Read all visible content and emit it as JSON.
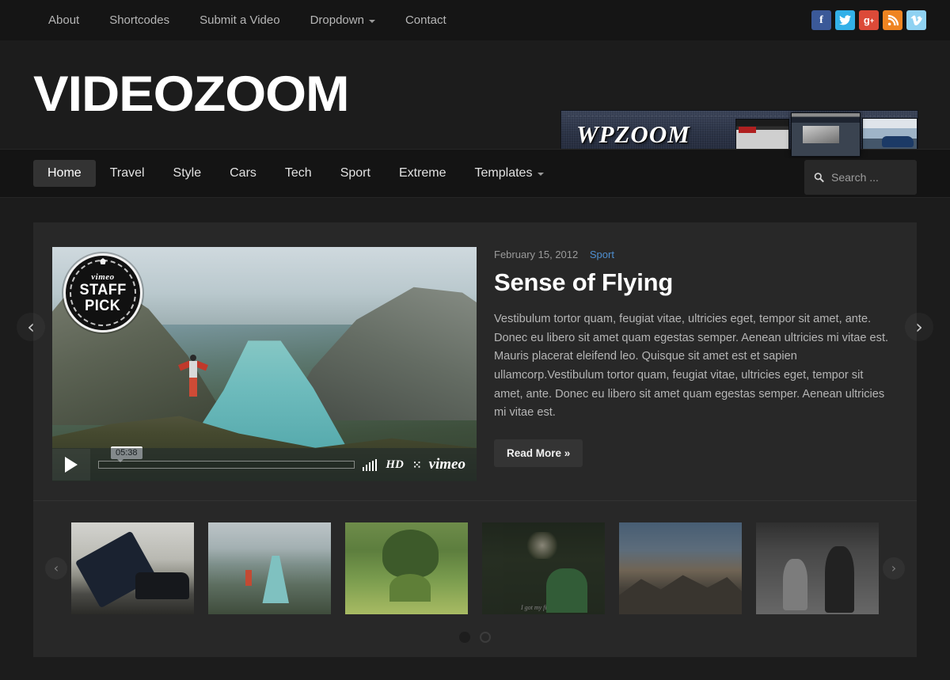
{
  "topbar": {
    "nav": [
      {
        "label": "About",
        "has_caret": false
      },
      {
        "label": "Shortcodes",
        "has_caret": false
      },
      {
        "label": "Submit a Video",
        "has_caret": false
      },
      {
        "label": "Dropdown",
        "has_caret": true
      },
      {
        "label": "Contact",
        "has_caret": false
      }
    ],
    "social": [
      {
        "name": "facebook",
        "glyph": "f",
        "color": "#3b5998"
      },
      {
        "name": "twitter",
        "glyph": "t",
        "color": "#33b0e8"
      },
      {
        "name": "google-plus",
        "glyph": "g+",
        "color": "#dc4a38"
      },
      {
        "name": "rss",
        "glyph": "rss",
        "color": "#ef8421"
      },
      {
        "name": "vimeo",
        "glyph": "v",
        "color": "#8fd2f2"
      }
    ]
  },
  "header": {
    "logo": "VIDEOZOOM",
    "banner": {
      "word": "WPZOOM"
    }
  },
  "mainnav": {
    "items": [
      {
        "label": "Home",
        "active": true,
        "has_caret": false
      },
      {
        "label": "Travel",
        "active": false,
        "has_caret": false
      },
      {
        "label": "Style",
        "active": false,
        "has_caret": false
      },
      {
        "label": "Cars",
        "active": false,
        "has_caret": false
      },
      {
        "label": "Tech",
        "active": false,
        "has_caret": false
      },
      {
        "label": "Sport",
        "active": false,
        "has_caret": false
      },
      {
        "label": "Extreme",
        "active": false,
        "has_caret": false
      },
      {
        "label": "Templates",
        "active": false,
        "has_caret": true
      }
    ],
    "search": {
      "placeholder": "Search ...",
      "value": ""
    }
  },
  "feature": {
    "date": "February 15, 2012",
    "category": "Sport",
    "title": "Sense of Flying",
    "excerpt": "Vestibulum tortor quam, feugiat vitae, ultricies eget, tempor sit amet, ante. Donec eu libero sit amet quam egestas semper. Aenean ultricies mi vitae est. Mauris placerat eleifend leo. Quisque sit amet est et sapien ullamcorp.Vestibulum tortor quam, feugiat vitae, ultricies eget, tempor sit amet, ante. Donec eu libero sit amet quam egestas semper. Aenean ultricies mi vitae est.",
    "read_more": "Read More »",
    "prev_arrow": "‹",
    "next_arrow": "›",
    "player": {
      "badge_brand": "vimeo",
      "badge_line1": "STAFF",
      "badge_line2": "PICK",
      "duration": "05:38",
      "hd_label": "HD",
      "brand": "vimeo"
    }
  },
  "carousel": {
    "prev_arrow": "‹",
    "next_arrow": "›",
    "thumbs": [
      {
        "name": "thumb-car-crash",
        "caption": ""
      },
      {
        "name": "thumb-fjord-wingsuit",
        "caption": ""
      },
      {
        "name": "thumb-green-hill",
        "caption": ""
      },
      {
        "name": "thumb-children",
        "caption": "I got my first kiss."
      },
      {
        "name": "thumb-mountain-sunset",
        "caption": ""
      },
      {
        "name": "thumb-street-bw",
        "caption": ""
      }
    ],
    "dots": [
      {
        "state": "filled"
      },
      {
        "state": "hollow"
      }
    ]
  }
}
